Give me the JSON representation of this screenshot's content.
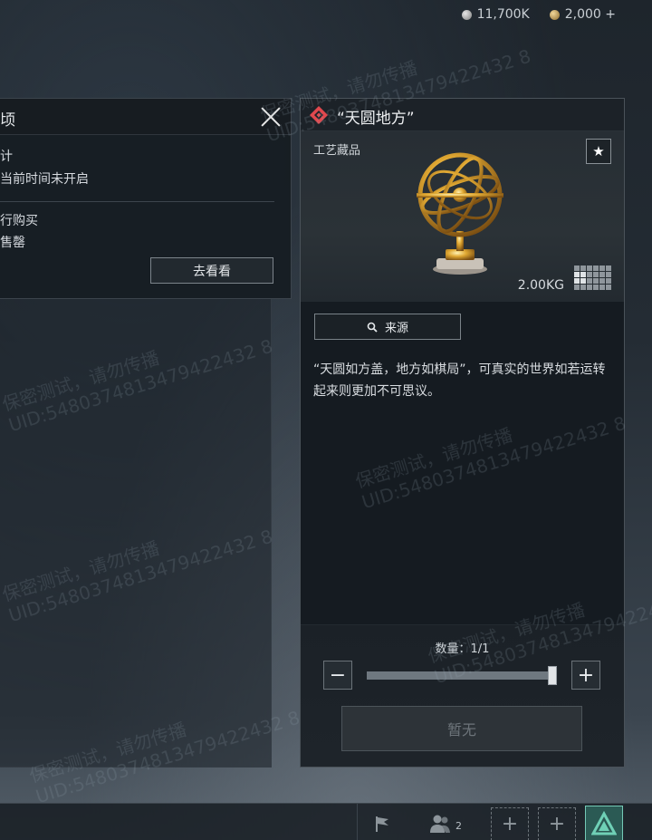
{
  "currency": {
    "silver_icon": "silver-coin-icon",
    "silver": "11,700K",
    "gold_icon": "gold-coin-icon",
    "gold": "2,000 +"
  },
  "left_panel": {
    "title": "顷",
    "line1": "计",
    "line2": "当前时间未开启",
    "line3": "行购买",
    "line4": "售罄",
    "goto_button": "去看看"
  },
  "item": {
    "title": "“天圆地方”",
    "rarity_color": "#e0484e",
    "category": "工艺藏品",
    "favorite_icon": "★",
    "weight": "2.00KG",
    "source_label": "来源",
    "description": "“天圆如方盖，地方如棋局”，可真实的世界如若运转起来则更加不可思议。",
    "quantity_label": "数量：1/1",
    "quantity_fraction": 1.0,
    "minus": "−",
    "plus": "+",
    "buy_button": "暂无"
  },
  "bottom_bar": {
    "people_count": "2",
    "slot1": "+",
    "slot2": "+",
    "team_color": "#6fd0b6"
  },
  "watermarks": {
    "line1": "保密测试，请勿传播",
    "line2": "UID:5480374813479422432 8"
  }
}
